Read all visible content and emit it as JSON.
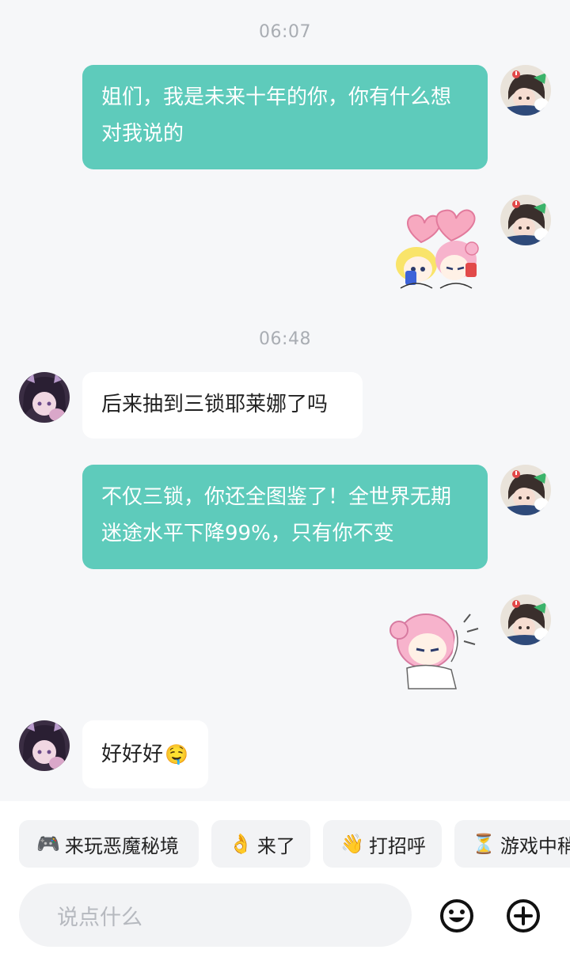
{
  "messages": {
    "time1": "06:07",
    "msg1": "姐们，我是未来十年的你，你有什么想对我说的",
    "time2": "06:48",
    "msg2": "后来抽到三锁耶莱娜了吗",
    "msg3": "不仅三锁，你还全图鉴了！全世界无期迷途水平下降99%，只有你不变",
    "msg4": "好好好"
  },
  "quick_replies": [
    {
      "icon": "🎮",
      "label": "来玩恶魔秘境"
    },
    {
      "icon": "👌",
      "label": "来了"
    },
    {
      "icon": "👋",
      "label": "打招呼"
    },
    {
      "icon": "⏳",
      "label": "游戏中稍"
    }
  ],
  "composer": {
    "placeholder": "说点什么",
    "emoji_icon": "emoji-face-icon",
    "add_icon": "plus-circle-icon"
  },
  "inline_emoji": "🤤",
  "colors": {
    "accent_bubble": "#5ecbbb",
    "background": "#f6f7f9",
    "timestamp": "#a9adb3"
  }
}
